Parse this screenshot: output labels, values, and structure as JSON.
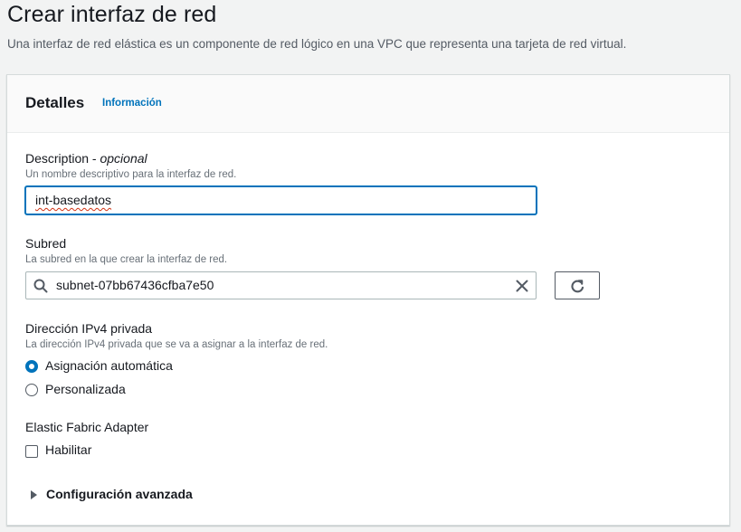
{
  "page": {
    "title": "Crear interfaz de red",
    "description": "Una interfaz de red elástica es un componente de red lógico en una VPC que representa una tarjeta de red virtual."
  },
  "details": {
    "title": "Detalles",
    "info_link": "Información",
    "description_field": {
      "label": "Description - ",
      "label_optional": "opcional",
      "hint": "Un nombre descriptivo para la interfaz de red.",
      "value": "int-basedatos"
    },
    "subnet_field": {
      "label": "Subred",
      "hint": "La subred en la que crear la interfaz de red.",
      "value": "subnet-07bb67436cfba7e50",
      "search_icon": "search-icon",
      "clear_icon": "close-icon",
      "refresh_icon": "refresh-icon"
    },
    "ipv4_field": {
      "label": "Dirección IPv4 privada",
      "hint": "La dirección IPv4 privada que se va a asignar a la interfaz de red.",
      "options": [
        {
          "label": "Asignación automática",
          "selected": true
        },
        {
          "label": "Personalizada",
          "selected": false
        }
      ]
    },
    "efa_field": {
      "label": "Elastic Fabric Adapter",
      "checkbox_label": "Habilitar",
      "checked": false
    },
    "advanced": {
      "label": "Configuración avanzada",
      "expanded": false
    }
  },
  "colors": {
    "accent": "#0073bb",
    "link": "#0073bb",
    "text": "#16191f",
    "muted": "#687078",
    "background": "#f2f3f3"
  }
}
